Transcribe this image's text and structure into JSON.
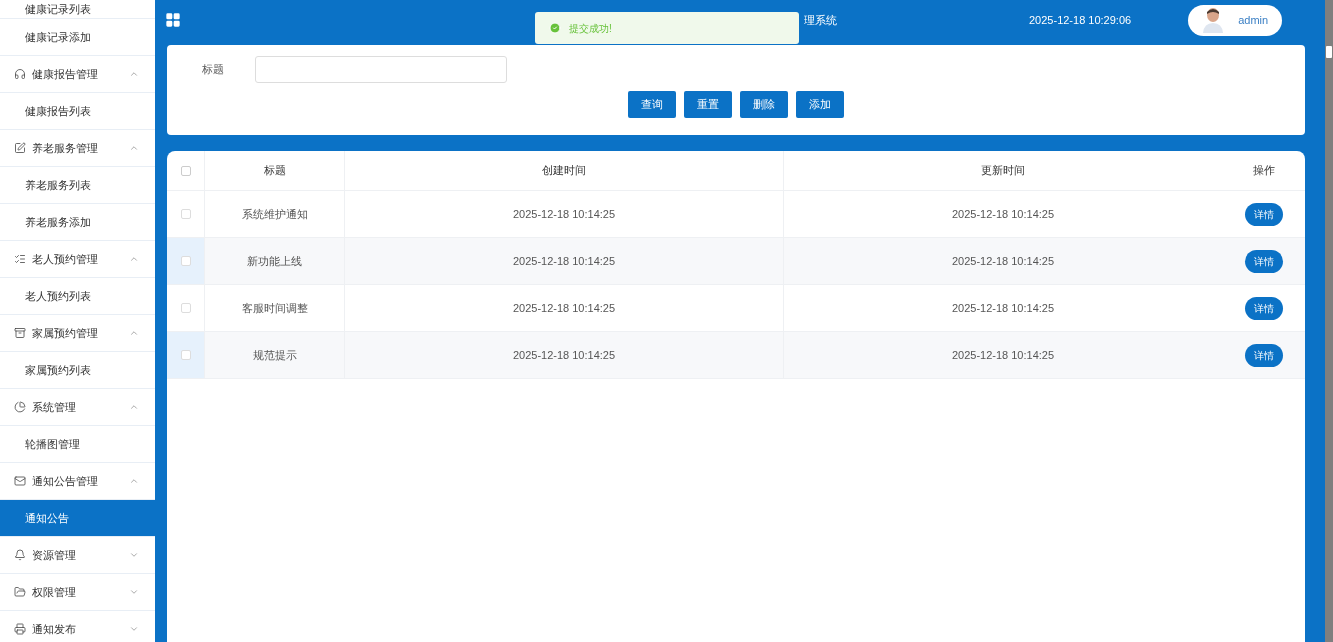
{
  "sidebar": {
    "items": [
      {
        "label": "健康记录列表",
        "selected": false
      },
      {
        "label": "健康记录添加",
        "selected": false
      },
      {
        "label": "健康报告管理",
        "expanded": true,
        "children": [
          {
            "label": "健康报告列表",
            "selected": false
          }
        ]
      },
      {
        "label": "养老服务管理",
        "expanded": true,
        "children": [
          {
            "label": "养老服务列表",
            "selected": false
          },
          {
            "label": "养老服务添加",
            "selected": false
          }
        ]
      },
      {
        "label": "老人预约管理",
        "expanded": true,
        "children": [
          {
            "label": "老人预约列表",
            "selected": false
          }
        ]
      },
      {
        "label": "家属预约管理",
        "expanded": true,
        "children": [
          {
            "label": "家属预约列表",
            "selected": false
          }
        ]
      },
      {
        "label": "系统管理",
        "expanded": true,
        "children": [
          {
            "label": "轮播图管理",
            "selected": false
          }
        ]
      },
      {
        "label": "通知公告管理",
        "expanded": true,
        "children": [
          {
            "label": "通知公告",
            "selected": true
          }
        ]
      },
      {
        "label": "资源管理",
        "expanded": false
      },
      {
        "label": "权限管理",
        "expanded": false
      },
      {
        "label": "通知发布",
        "expanded": false
      }
    ]
  },
  "header": {
    "title": "理系统",
    "datetime": "2025-12-18 10:29:06",
    "user": "admin"
  },
  "toast": {
    "message": "提交成功!"
  },
  "search": {
    "label": "标题",
    "buttons": [
      "查询",
      "重置",
      "删除",
      "添加"
    ]
  },
  "table": {
    "all_checked": false,
    "columns": [
      "标题",
      "创建时间",
      "更新时间",
      "操作"
    ],
    "rows": [
      {
        "title": "系统维护通知",
        "created": "2025-12-18 10:14:25",
        "updated": "2025-12-18 10:14:25",
        "action": "详情",
        "checked": false
      },
      {
        "title": "新功能上线",
        "created": "2025-12-18 10:14:25",
        "updated": "2025-12-18 10:14:25",
        "action": "详情",
        "checked": false
      },
      {
        "title": "客服时间调整",
        "created": "2025-12-18 10:14:25",
        "updated": "2025-12-18 10:14:25",
        "action": "详情",
        "checked": false
      },
      {
        "title": "规范提示",
        "created": "2025-12-18 10:14:25",
        "updated": "2025-12-18 10:14:25",
        "action": "详情",
        "checked": false
      }
    ]
  }
}
